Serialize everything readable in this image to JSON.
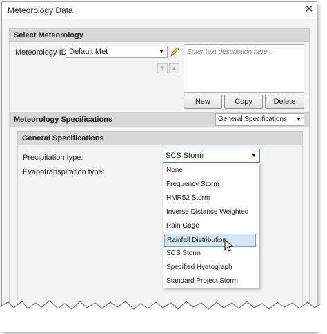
{
  "window": {
    "title": "Meteorology Data",
    "close_icon": "close-icon"
  },
  "select_meteorology": {
    "header": "Select Meteorology",
    "id_label": "Meteorology ID:",
    "id_value": "Default Met",
    "description_placeholder": "Enter text description here...",
    "buttons": {
      "new": "New",
      "copy": "Copy",
      "delete": "Delete"
    }
  },
  "specs": {
    "header": "Meteorology Specifications",
    "view_value": "General Specifications",
    "general_header": "General Specifications",
    "precip_label": "Precipitation type:",
    "precip_value": "SCS Storm",
    "evapo_label": "Evapotranspiration type:",
    "options": [
      "None",
      "Frequency Storm",
      "HMR52 Storm",
      "Inverse Distance Weighted",
      "Rain Gage",
      "Rainfall Distribution",
      "SCS Storm",
      "Specified Hyetograph",
      "Standard Project Storm"
    ],
    "highlighted_option": "Rainfall Distribution"
  }
}
